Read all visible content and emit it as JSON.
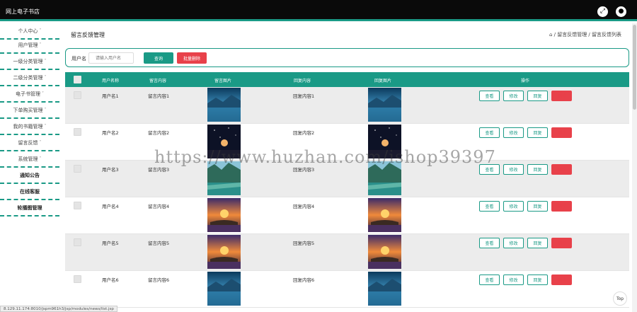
{
  "app": {
    "title": "网上电子书店"
  },
  "header_icons": [
    "fullscreen-icon",
    "user-icon"
  ],
  "sidebar": {
    "items": [
      {
        "label": "个人中心",
        "chev": "˅"
      },
      {
        "label": "用户管理",
        "chev": "˅"
      },
      {
        "label": "一级分类管理",
        "chev": "˅"
      },
      {
        "label": "二级分类管理",
        "chev": "˅"
      },
      {
        "label": "电子书管理",
        "chev": "˅"
      },
      {
        "label": "下单购买管理",
        "chev": "˅"
      },
      {
        "label": "我的书籍管理",
        "chev": "˅"
      },
      {
        "label": "留言反馈",
        "chev": "˅"
      },
      {
        "label": "系统管理",
        "chev": "˅"
      },
      {
        "label": "通知公告",
        "chev": ""
      },
      {
        "label": "在线客服",
        "chev": ""
      },
      {
        "label": "轮播图管理",
        "chev": ""
      }
    ]
  },
  "page": {
    "title": "留言反馈管理",
    "breadcrumb": "⌂ / 留言反馈管理 / 留言反馈列表"
  },
  "search": {
    "label": "用户名",
    "placeholder": "请输入用户名",
    "query_label": "查询",
    "batch_delete_label": "批量删除"
  },
  "table": {
    "headers": [
      "用户名称",
      "留言内容",
      "留言图片",
      "回复内容",
      "回复图片",
      "操作"
    ],
    "rows": [
      {
        "user": "用户名1",
        "content": "留言内容1",
        "reply": "回复内容1",
        "img": "lake"
      },
      {
        "user": "用户名2",
        "content": "留言内容2",
        "reply": "回复内容2",
        "img": "night"
      },
      {
        "user": "用户名3",
        "content": "留言内容3",
        "reply": "回复内容3",
        "img": "valley"
      },
      {
        "user": "用户名4",
        "content": "留言内容4",
        "reply": "回复内容4",
        "img": "sunset"
      },
      {
        "user": "用户名5",
        "content": "留言内容5",
        "reply": "回复内容5",
        "img": "sunset"
      },
      {
        "user": "用户名6",
        "content": "留言内容6",
        "reply": "回复内容6",
        "img": "lake"
      }
    ],
    "actions": [
      "查看",
      "修改",
      "回复",
      "删除"
    ]
  },
  "status_url": "8.129.11.174:8010/jspm961h3/jsp/modules/news/list.jsp",
  "watermark": "https://www.huzhan.com/ishop39397",
  "top_button": "Top",
  "colors": {
    "accent": "#1a9a86",
    "danger": "#e8414a",
    "header": "#0a0a0a"
  }
}
